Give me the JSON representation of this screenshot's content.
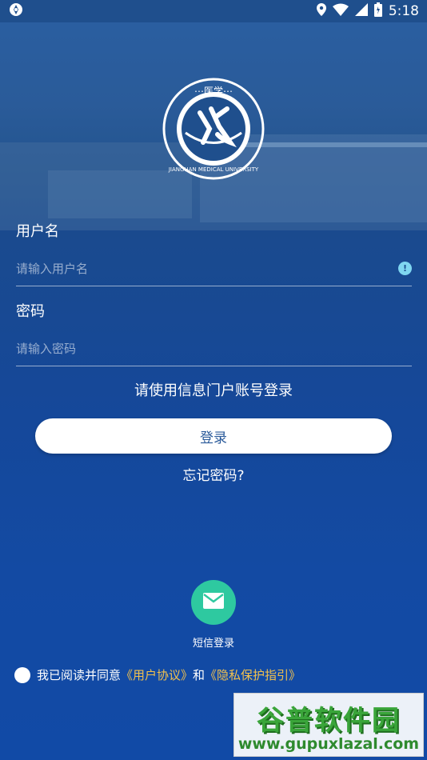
{
  "status_bar": {
    "time": "5:18"
  },
  "login": {
    "username_label": "用户名",
    "username_placeholder": "请输入用户名",
    "password_label": "密码",
    "password_placeholder": "请输入密码",
    "hint": "请使用信息门户账号登录",
    "login_button": "登录",
    "forgot_password": "忘记密码?"
  },
  "sms": {
    "label": "短信登录"
  },
  "agreement": {
    "prefix": "我已阅读并同意",
    "user_agreement": "《用户协议》",
    "and": "和",
    "privacy": "《隐私保护指引》"
  },
  "watermark": {
    "title": "谷普软件园",
    "url": "www.gupuxlazal.com"
  },
  "logo": {
    "ring_text_top": "...医学...",
    "ring_text_bottom": "JIANGHAN MEDICAL UNIVERSITY"
  },
  "colors": {
    "background": "#1a4a8e",
    "accent_link": "#f2c14e",
    "sms_green": "#2ec9a0",
    "info_icon": "#7fd6f0"
  }
}
